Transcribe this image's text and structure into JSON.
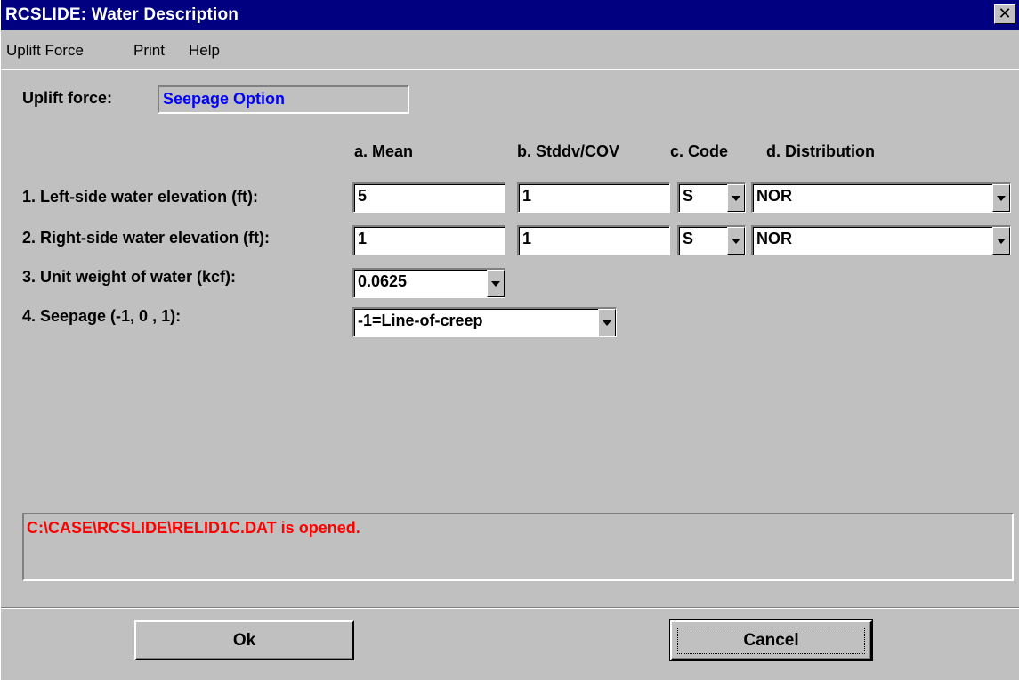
{
  "window": {
    "title": "RCSLIDE:  Water Description",
    "close_glyph": "✕"
  },
  "menu": {
    "items": [
      "Uplift Force",
      "Print",
      "Help"
    ]
  },
  "uplift": {
    "label": "Uplift force:",
    "value": "Seepage Option"
  },
  "columns": {
    "mean": "a. Mean",
    "stddv": "b. Stddv/COV",
    "code": "c. Code",
    "distribution": "d. Distribution"
  },
  "rows": [
    {
      "label": "1. Left-side water elevation (ft):",
      "mean": "5",
      "stddv": "1",
      "code": "S",
      "distribution": "NOR"
    },
    {
      "label": "2. Right-side water elevation (ft):",
      "mean": "1",
      "stddv": "1",
      "code": "S",
      "distribution": "NOR"
    }
  ],
  "unit_weight": {
    "label": "3. Unit weight of water (kcf):",
    "value": "0.0625"
  },
  "seepage": {
    "label": "4. Seepage (-1, 0 , 1):",
    "value": "-1=Line-of-creep"
  },
  "status": {
    "message": "C:\\CASE\\RCSLIDE\\RELID1C.DAT is opened."
  },
  "buttons": {
    "ok": "Ok",
    "cancel": "Cancel"
  }
}
